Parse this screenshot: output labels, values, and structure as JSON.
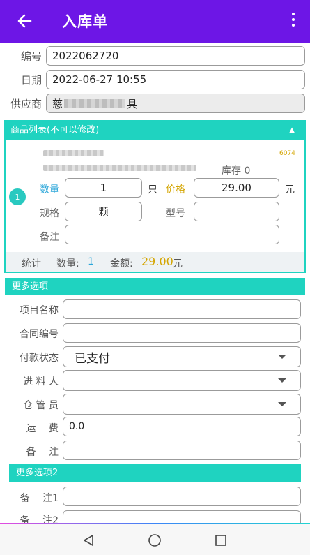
{
  "header": {
    "title": "入库单",
    "back_icon": "arrow-left-icon",
    "menu_icon": "more-vert-icon"
  },
  "form": {
    "number_label": "编号",
    "number_value": "2022062720",
    "date_label": "日期",
    "date_value": "2022-06-27 10:55",
    "supplier_label": "供应商",
    "supplier_prefix": "慈",
    "supplier_suffix": "具"
  },
  "goods": {
    "header": "商品列表(不可以修改)",
    "code": "6074",
    "stock": "库存 0",
    "index": "1",
    "qty_label": "数量",
    "qty_value": "1",
    "qty_unit": "只",
    "price_label": "价格",
    "price_value": "29.00",
    "price_unit": "元",
    "spec_label": "规格",
    "spec_value": "颗",
    "model_label": "型号",
    "model_value": "",
    "remark_label": "备注",
    "remark_value": "",
    "stat_label": "统计",
    "stat_qty_label": "数量:",
    "stat_qty_value": "1",
    "stat_amount_label": "金额:",
    "stat_amount_value": "29.00",
    "stat_amount_unit": "元"
  },
  "more": {
    "header": "更多选项",
    "project_label": "项目名称",
    "contract_label": "合同编号",
    "payment_label": "付款状态",
    "payment_value": "已支付",
    "incoming_label": "进 料 人",
    "keeper_label": "仓 管 员",
    "freight_label": "运　 费",
    "freight_value": "0.0",
    "remark_label": "备　 注"
  },
  "more2": {
    "header": "更多选项2",
    "remark1_label": "备　 注1",
    "remark2_label": "备　 注2"
  },
  "colors": {
    "primary": "#6d16e6",
    "accent": "#1fd3c0",
    "price": "#d4a500",
    "qty": "#2aa6d9"
  }
}
